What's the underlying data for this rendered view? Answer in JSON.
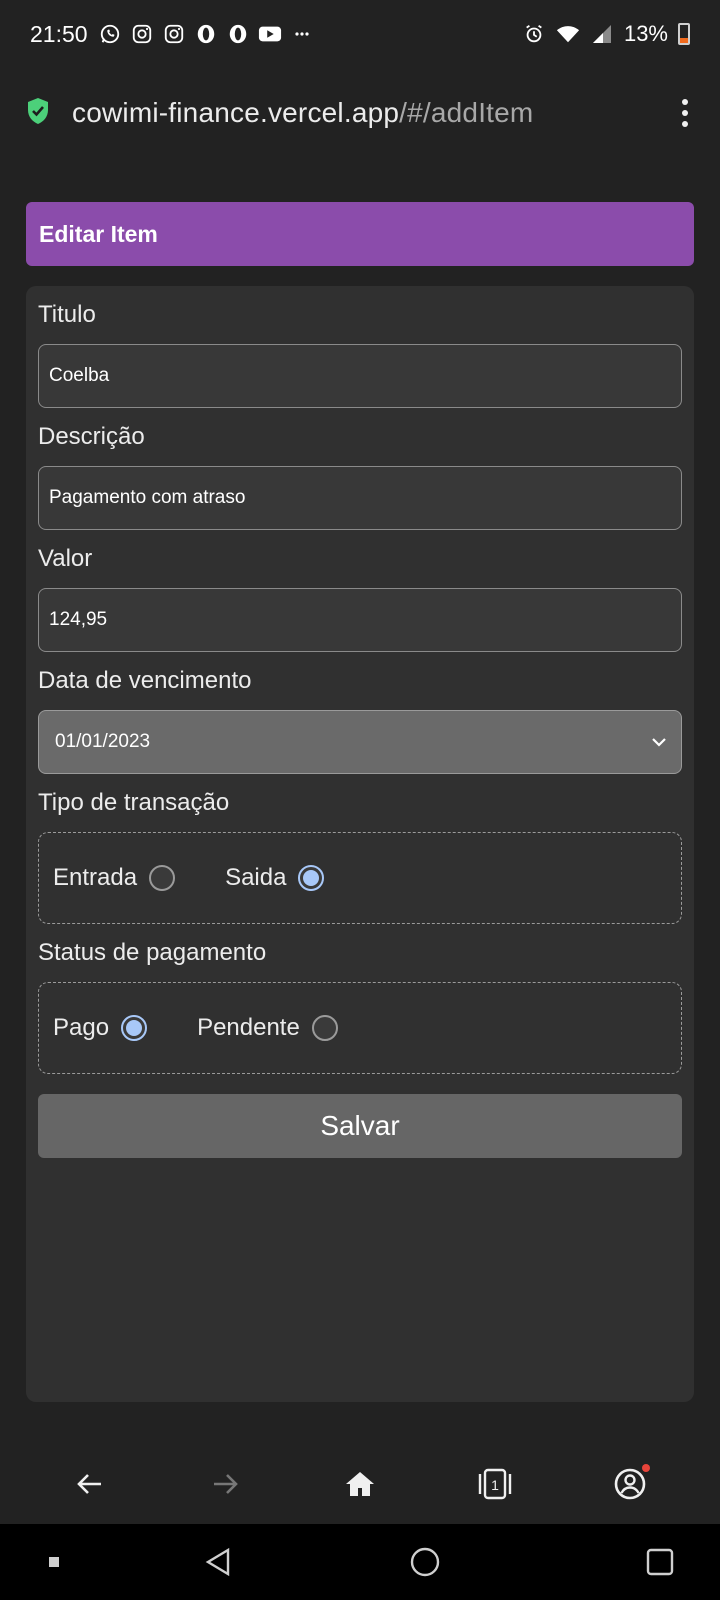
{
  "status_bar": {
    "time": "21:50",
    "notification_icons": [
      "whatsapp-icon",
      "instagram-icon",
      "instagram-icon",
      "opera-icon",
      "opera-icon",
      "youtube-icon",
      "more-notifications-icon"
    ],
    "right_icons": [
      "alarm-icon",
      "wifi-icon",
      "signal-icon"
    ],
    "battery": "13%"
  },
  "browser": {
    "url_domain": "cowimi-finance.vercel.app",
    "url_path": "/#/addItem",
    "secure_color": "#4cd07a"
  },
  "page": {
    "title": "Editar Item",
    "header_color": "#8b4cab"
  },
  "form": {
    "titulo": {
      "label": "Titulo",
      "value": "Coelba"
    },
    "descricao": {
      "label": "Descrição",
      "value": "Pagamento com atraso"
    },
    "valor": {
      "label": "Valor",
      "value": "124,95"
    },
    "vencimento": {
      "label": "Data de vencimento",
      "value": "01/01/2023"
    },
    "tipo": {
      "label": "Tipo de transação",
      "options": [
        {
          "label": "Entrada",
          "checked": false
        },
        {
          "label": "Saida",
          "checked": true
        }
      ]
    },
    "status": {
      "label": "Status de pagamento",
      "options": [
        {
          "label": "Pago",
          "checked": true
        },
        {
          "label": "Pendente",
          "checked": false
        }
      ]
    },
    "save_label": "Salvar"
  },
  "browser_nav": {
    "tabs_count": "1",
    "items": [
      "back-arrow-icon",
      "forward-arrow-icon",
      "home-icon",
      "tabs-icon",
      "account-icon"
    ]
  },
  "system_nav": [
    "recents-dot-icon",
    "back-triangle-icon",
    "home-circle-icon",
    "overview-square-icon"
  ]
}
